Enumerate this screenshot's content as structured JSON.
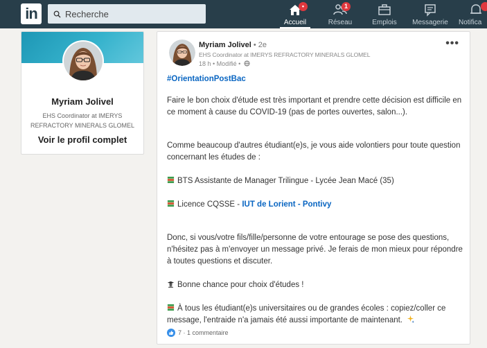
{
  "nav": {
    "logo_text": "in",
    "search_placeholder": "Recherche",
    "items": [
      {
        "label": "Accueil",
        "icon": "home-icon",
        "badge": "",
        "active": true
      },
      {
        "label": "Réseau",
        "icon": "network-icon",
        "badge": "1"
      },
      {
        "label": "Emplois",
        "icon": "briefcase-icon",
        "badge": ""
      },
      {
        "label": "Messagerie",
        "icon": "messaging-icon",
        "badge": ""
      },
      {
        "label": "Notifica",
        "icon": "bell-icon",
        "badge": ""
      }
    ],
    "home_badge": "•"
  },
  "profile": {
    "name": "Myriam Jolivel",
    "headline": "EHS Coordinator at IMERYS REFRACTORY MINERALS GLOMEL",
    "view_profile": "Voir le profil complet"
  },
  "post": {
    "author_name": "Myriam Jolivel",
    "degree": " • 2e",
    "headline": "EHS Coordinator at IMERYS REFRACTORY MINERALS GLOMEL",
    "meta": "18 h • Modifié •",
    "more": "•••",
    "hashtag": "#OrientationPostBac",
    "p1": "Faire le bon choix d'étude est très important et prendre cette décision est difficile en ce moment à cause du COVID-19 (pas de portes ouvertes, salon...).",
    "p2": "Comme beaucoup d'autres étudiant(e)s, je vous aide volontiers pour toute question concernant les études de :",
    "bts": "BTS Assistante de Manager Trilingue - Lycée Jean Macé (35)",
    "licence_prefix": "Licence CQSSE - ",
    "licence_link": "IUT de Lorient - Pontivy",
    "p3": "Donc, si vous/votre fils/fille/personne de votre entourage se pose des questions, n'hésitez pas à m'envoyer un message privé. Je ferais de mon mieux pour répondre à toutes questions et discuter.",
    "p4": "Bonne chance pour choix d'études !",
    "p5": "À tous les étudiant(e)s universitaires ou de grandes écoles : copiez/coller ce message, l'entraide n'a jamais été aussi importante de maintenant.",
    "reactions": "7 · 1 commentaire"
  },
  "colors": {
    "nav_bg": "#283e4a",
    "link_blue": "#0a66c2",
    "badge_red": "#e0383e"
  }
}
